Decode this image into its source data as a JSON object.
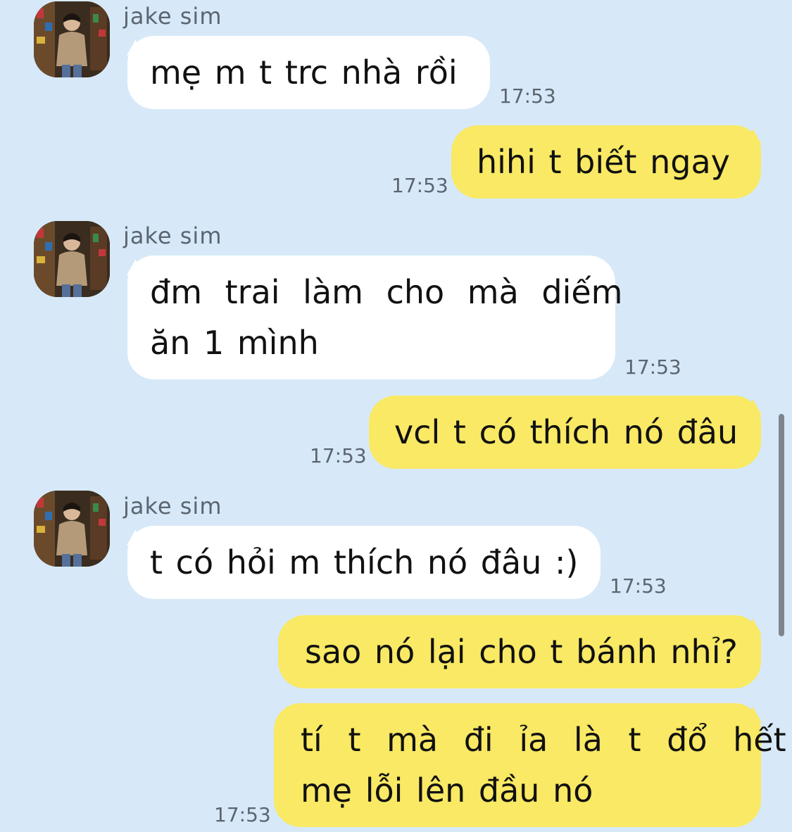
{
  "colors": {
    "background": "#d7e9f8",
    "incoming_bubble": "#ffffff",
    "outgoing_bubble": "#f9e964",
    "meta_text": "#5b6570"
  },
  "messages": [
    {
      "direction": "incoming",
      "sender": "jake sim",
      "text": "mẹ m t trc nhà rồi",
      "time": "17:53"
    },
    {
      "direction": "outgoing",
      "text": "hihi t biết ngay",
      "time": "17:53"
    },
    {
      "direction": "incoming",
      "sender": "jake sim",
      "lines": [
        "đm trai làm cho mà diếm",
        "ăn 1 mình"
      ],
      "time": "17:53"
    },
    {
      "direction": "outgoing",
      "text": "vcl t có thích nó đâu",
      "time": "17:53"
    },
    {
      "direction": "incoming",
      "sender": "jake sim",
      "text": "t có hỏi m thích nó đâu :)",
      "time": "17:53"
    },
    {
      "direction": "outgoing",
      "text": "sao nó lại cho t bánh nhỉ?",
      "time": "17:53"
    },
    {
      "direction": "outgoing",
      "lines": [
        "tí t mà đi ỉa là t đổ hết",
        "mẹ lỗi lên đầu nó"
      ],
      "time": "17:53"
    }
  ]
}
